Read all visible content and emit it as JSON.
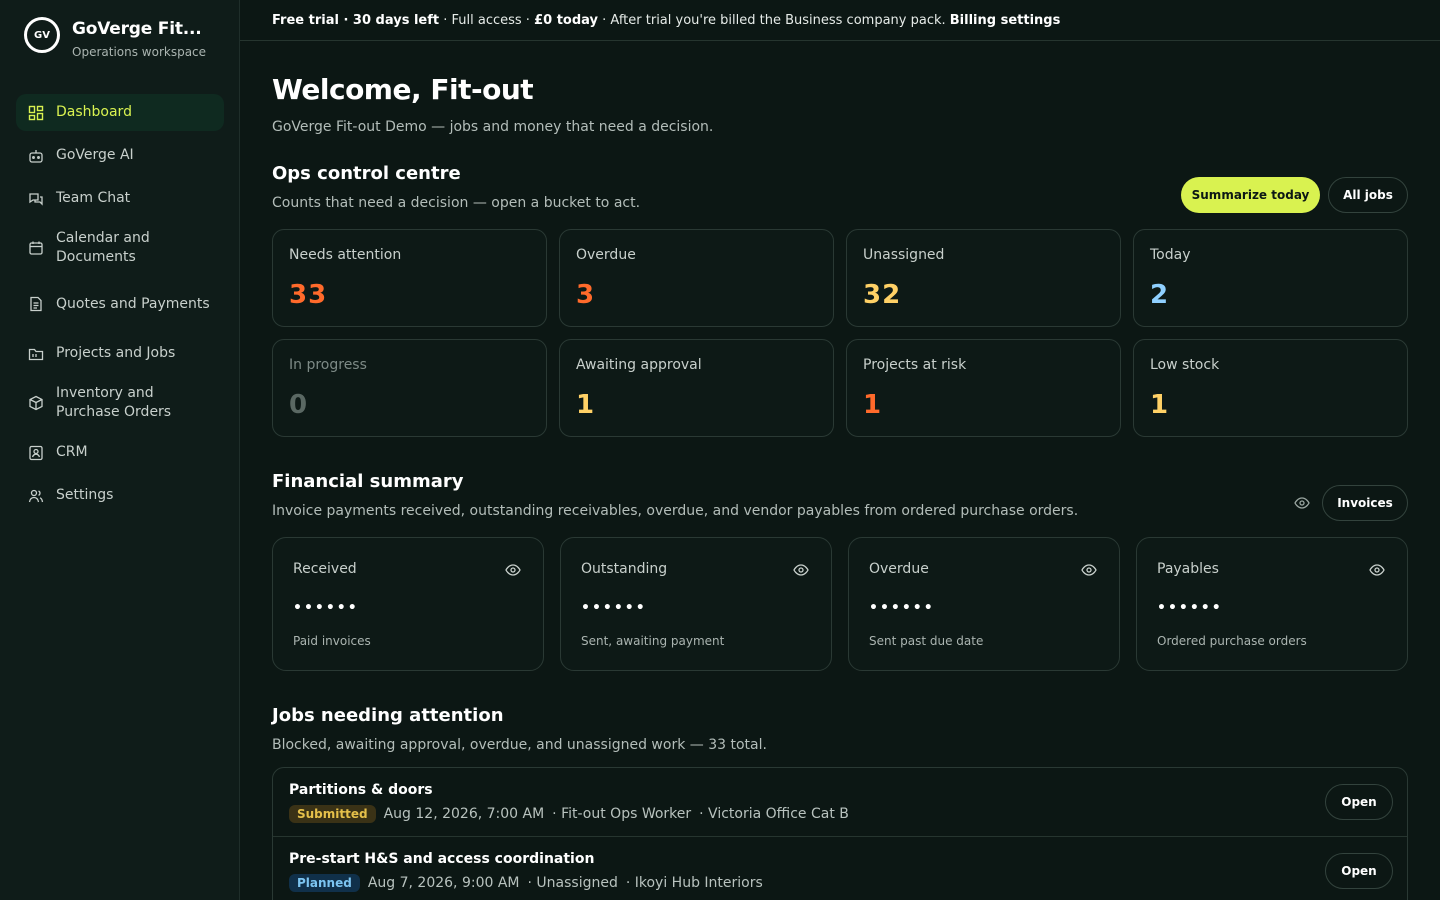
{
  "brand": {
    "logo_text": "GV",
    "title": "GoVerge Fit...",
    "subtitle": "Operations workspace"
  },
  "sidebar": {
    "items": [
      {
        "label": "Dashboard",
        "icon": "grid-icon",
        "active": true
      },
      {
        "label": "GoVerge AI",
        "icon": "robot-icon"
      },
      {
        "label": "Team Chat",
        "icon": "chat-icon"
      },
      {
        "label": "Calendar and Documents",
        "icon": "calendar-icon"
      },
      {
        "label": "Quotes and Payments",
        "icon": "document-icon"
      },
      {
        "label": "Projects and Jobs",
        "icon": "folder-icon"
      },
      {
        "label": "Inventory and Purchase Orders",
        "icon": "box-icon"
      },
      {
        "label": "CRM",
        "icon": "contact-icon"
      },
      {
        "label": "Settings",
        "icon": "users-icon"
      }
    ]
  },
  "topbar": {
    "trial_bold": "Free trial · 30 days left",
    "middle": " · Full access · ",
    "price_bold": "£0 today",
    "after": " · After trial you're billed the Business company pack. ",
    "billing_link": "Billing settings"
  },
  "header": {
    "title": "Welcome, Fit-out",
    "subtitle": "GoVerge Fit-out Demo — jobs and money that need a decision."
  },
  "ops": {
    "title": "Ops control centre",
    "subtitle": "Counts that need a decision — open a bucket to act.",
    "summarize_button": "Summarize today",
    "all_jobs_button": "All jobs",
    "cards": [
      {
        "label": "Needs attention",
        "value": "33",
        "color": "#ff6a2b"
      },
      {
        "label": "Overdue",
        "value": "3",
        "color": "#ff6a2b"
      },
      {
        "label": "Unassigned",
        "value": "32",
        "color": "#ffd166"
      },
      {
        "label": "Today",
        "value": "2",
        "color": "#8fd0ff"
      },
      {
        "label": "In progress",
        "value": "0",
        "color": "#5a6863"
      },
      {
        "label": "Awaiting approval",
        "value": "1",
        "color": "#ffd166"
      },
      {
        "label": "Projects at risk",
        "value": "1",
        "color": "#ff6a2b"
      },
      {
        "label": "Low stock",
        "value": "1",
        "color": "#ffd166"
      }
    ]
  },
  "financial": {
    "title": "Financial summary",
    "subtitle": "Invoice payments received, outstanding receivables, overdue, and vendor payables from ordered purchase orders.",
    "invoices_button": "Invoices",
    "cards": [
      {
        "label": "Received",
        "value": "••••••",
        "note": "Paid invoices"
      },
      {
        "label": "Outstanding",
        "value": "••••••",
        "note": "Sent, awaiting payment"
      },
      {
        "label": "Overdue",
        "value": "••••••",
        "note": "Sent past due date"
      },
      {
        "label": "Payables",
        "value": "••••••",
        "note": "Ordered purchase orders"
      }
    ]
  },
  "jobs": {
    "title": "Jobs needing attention",
    "subtitle": "Blocked, awaiting approval, overdue, and unassigned work — 33 total.",
    "rows": [
      {
        "title": "Partitions & doors",
        "status": "Submitted",
        "date": "Aug 12, 2026, 7:00 AM",
        "assignee": "· Fit-out Ops Worker",
        "client": "· Victoria Office Cat B",
        "open": "Open"
      },
      {
        "title": "Pre-start H&S and access coordination",
        "status": "Planned",
        "date": "Aug 7, 2026, 9:00 AM",
        "assignee": "· Unassigned",
        "client": "· Ikoyi Hub Interiors",
        "open": "Open"
      }
    ]
  }
}
